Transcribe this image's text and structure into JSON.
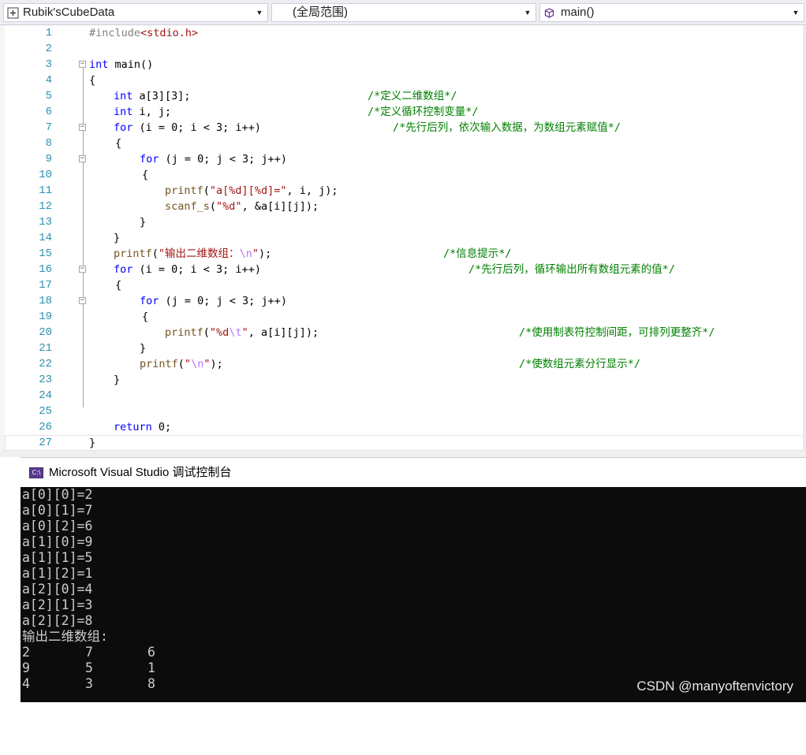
{
  "navbar": {
    "project": "Rubik'sCubeData",
    "scope": "(全局范围)",
    "member": "main()"
  },
  "code_lines": [
    {
      "n": "1"
    },
    {
      "n": "2"
    },
    {
      "n": "3"
    },
    {
      "n": "4"
    },
    {
      "n": "5"
    },
    {
      "n": "6"
    },
    {
      "n": "7"
    },
    {
      "n": "8"
    },
    {
      "n": "9"
    },
    {
      "n": "10"
    },
    {
      "n": "11"
    },
    {
      "n": "12"
    },
    {
      "n": "13"
    },
    {
      "n": "14"
    },
    {
      "n": "15"
    },
    {
      "n": "16"
    },
    {
      "n": "17"
    },
    {
      "n": "18"
    },
    {
      "n": "19"
    },
    {
      "n": "20"
    },
    {
      "n": "21"
    },
    {
      "n": "22"
    },
    {
      "n": "23"
    },
    {
      "n": "24"
    },
    {
      "n": "25"
    },
    {
      "n": "26"
    },
    {
      "n": "27"
    }
  ],
  "code": {
    "l1_pp": "#include",
    "l1_hdr": "<stdio.h>",
    "l3_kw": "int",
    "l3_rest": " main()",
    "brace_open": "{",
    "brace_close": "}",
    "l5_kw": "int",
    "l5_rest": " a[3][3];",
    "l5_cmt": "/*定义二维数组*/",
    "l6_kw": "int",
    "l6_rest": " i, j;",
    "l6_cmt": "/*定义循环控制变量*/",
    "for_kw": "for",
    "l7_rest": " (i = 0; i < 3; i++)",
    "l7_cmt": "/*先行后列，依次输入数据，为数组元素赋值*/",
    "l9_rest": " (j = 0; j < 3; j++)",
    "printf": "printf",
    "l11_open": "(",
    "l11_str": "\"a[%d][%d]=\"",
    "l11_rest": ", i, j);",
    "l12_fn": "scanf_s",
    "l12_open": "(",
    "l12_str": "\"%d\"",
    "l12_rest": ", &a[i][j]);",
    "l15_str1": "\"输出二维数组：",
    "l15_esc": "\\n",
    "l15_str2": "\"",
    "l15_rest": ");",
    "l15_cmt": "/*信息提示*/",
    "l16_rest": " (i = 0; i < 3; i++)",
    "l16_cmt": "/*先行后列，循环输出所有数组元素的值*/",
    "l18_rest": " (j = 0; j < 3; j++)",
    "l20_str1": "\"%d",
    "l20_esc": "\\t",
    "l20_str2": "\"",
    "l20_rest": ", a[i][j]);",
    "l20_cmt": "/*使用制表符控制间距，可排列更整齐*/",
    "l22_str1": "\"",
    "l22_esc": "\\n",
    "l22_str2": "\"",
    "l22_rest": ");",
    "l22_cmt": "/*使数组元素分行显示*/",
    "l26_kw": "return",
    "l26_rest": " 0;"
  },
  "console": {
    "title": "Microsoft Visual Studio 调试控制台",
    "icon_label": "C:\\",
    "input_lines": [
      "a[0][0]=2",
      "a[0][1]=7",
      "a[0][2]=6",
      "a[1][0]=9",
      "a[1][1]=5",
      "a[1][2]=1",
      "a[2][0]=4",
      "a[2][1]=3",
      "a[2][2]=8"
    ],
    "header": "输出二维数组:",
    "matrix": [
      [
        "2",
        "7",
        "6"
      ],
      [
        "9",
        "5",
        "1"
      ],
      [
        "4",
        "3",
        "8"
      ]
    ]
  },
  "watermark": "CSDN @manyoftenvictory",
  "colors": {
    "keyword": "#0000ff",
    "comment": "#008000",
    "string": "#a31515",
    "escape": "#b776fb",
    "line_number": "#2b91af",
    "console_bg": "#0c0c0c",
    "console_text": "#cccccc"
  }
}
